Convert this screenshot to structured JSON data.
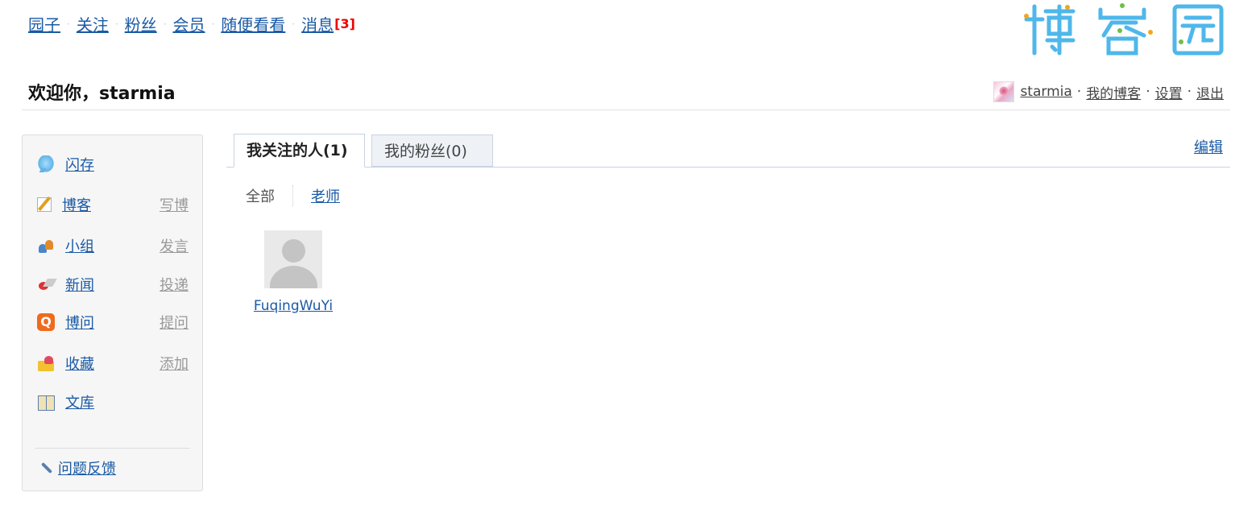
{
  "topnav": {
    "items": [
      "园子",
      "关注",
      "粉丝",
      "会员",
      "随便看看",
      "消息"
    ],
    "message_count": "[3]"
  },
  "logo": {
    "text": "博客园"
  },
  "welcome": {
    "text": "欢迎你，starmia"
  },
  "userbar": {
    "username": "starmia",
    "my_blog": "我的博客",
    "settings": "设置",
    "logout": "退出",
    "separator": "·"
  },
  "sidebar": {
    "items": [
      {
        "label": "闪存",
        "icon": "chat-bubble-icon",
        "action": ""
      },
      {
        "label": "博客",
        "icon": "notepad-icon",
        "action": "写博"
      },
      {
        "label": "小组",
        "icon": "group-icon",
        "action": "发言"
      },
      {
        "label": "新闻",
        "icon": "news-icon",
        "action": "投递"
      },
      {
        "label": "博问",
        "icon": "q-icon",
        "action": "提问"
      },
      {
        "label": "收藏",
        "icon": "folder-favorite-icon",
        "action": "添加"
      },
      {
        "label": "文库",
        "icon": "book-icon",
        "action": ""
      }
    ],
    "feedback": "问题反馈"
  },
  "tabs": {
    "following": "我关注的人(1)",
    "followers": "我的粉丝(0)",
    "edit": "编辑"
  },
  "groups": {
    "all": "全部",
    "teacher": "老师"
  },
  "people": [
    {
      "name": "FuqingWuYi"
    }
  ],
  "colors": {
    "link": "#1a5aa5",
    "message_count": "#ee0000",
    "logo_blue": "#4fb7ea",
    "logo_green": "#6cc04a",
    "logo_orange": "#f2a51e"
  }
}
